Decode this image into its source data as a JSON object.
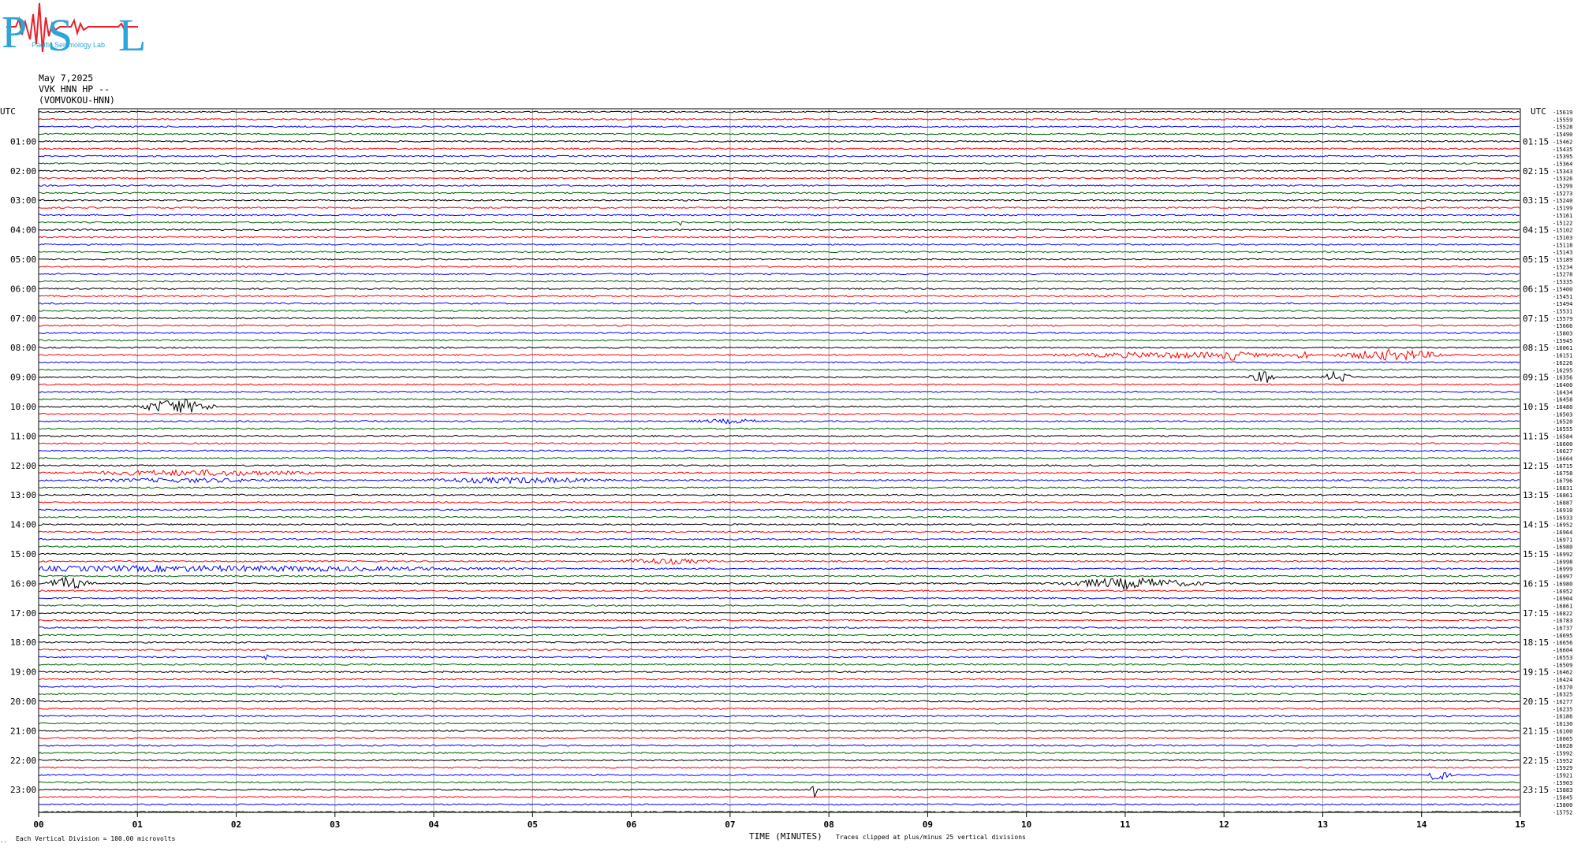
{
  "logo": {
    "letters": "PSL",
    "text": "Pacific Seismology Lab",
    "colors": {
      "letters": "#2aa6d8",
      "trace": "#e8212b"
    }
  },
  "header": {
    "date": "May 7,2025",
    "channel": "VVK HNN HP --",
    "station": "(VOMVOKOU-HNN)"
  },
  "footer": {
    "note_left": "Each Vertical Division =  100.00 microvolts",
    "corner_mark": "..",
    "xaxis_title": "TIME (MINUTES)",
    "clip_note": "Traces clipped at plus/minus 25 vertical divisions"
  },
  "chart_data": {
    "type": "line",
    "subtype": "helicorder",
    "title": "",
    "xlabel": "TIME (MINUTES)",
    "ylabel": "",
    "xlim": [
      0,
      15
    ],
    "x_ticks": [
      "00",
      "01",
      "02",
      "03",
      "04",
      "05",
      "06",
      "07",
      "08",
      "09",
      "10",
      "11",
      "12",
      "13",
      "14",
      "15"
    ],
    "left_axis_title": "UTC",
    "right_axis_title": "UTC",
    "left_hour_labels": [
      "01:00",
      "02:00",
      "03:00",
      "04:00",
      "05:00",
      "06:00",
      "07:00",
      "08:00",
      "09:00",
      "10:00",
      "11:00",
      "12:00",
      "13:00",
      "14:00",
      "15:00",
      "16:00",
      "17:00",
      "18:00",
      "19:00",
      "20:00",
      "21:00",
      "22:00",
      "23:00"
    ],
    "right_hour_labels": [
      "01:15",
      "02:15",
      "03:15",
      "04:15",
      "05:15",
      "06:15",
      "07:15",
      "08:15",
      "09:15",
      "10:15",
      "11:15",
      "12:15",
      "13:15",
      "14:15",
      "15:15",
      "16:15",
      "17:15",
      "18:15",
      "19:15",
      "20:15",
      "21:15",
      "22:15",
      "23:15"
    ],
    "trace_colors": [
      "#000000",
      "#ff0000",
      "#0000ff",
      "#006400"
    ],
    "grid": true,
    "trace_count": 96,
    "right_offsets": [
      "-15619",
      "-15559",
      "-15528",
      "-15490",
      "-15462",
      "-15435",
      "-15395",
      "-15364",
      "-15343",
      "-15326",
      "-15299",
      "-15273",
      "-15240",
      "-15199",
      "-15161",
      "-15122",
      "-15102",
      "-15103",
      "-15118",
      "-15143",
      "-15189",
      "-15234",
      "-15278",
      "-15335",
      "-15400",
      "-15451",
      "-15494",
      "-15531",
      "-15579",
      "-15666",
      "-15803",
      "-15945",
      "-16061",
      "-16151",
      "-16226",
      "-16295",
      "-16356",
      "-16400",
      "-16434",
      "-16458",
      "-16480",
      "-16503",
      "-16520",
      "-16555",
      "-16584",
      "-16600",
      "-16627",
      "-16664",
      "-16715",
      "-16758",
      "-16796",
      "-16831",
      "-16861",
      "-16887",
      "-16910",
      "-16933",
      "-16952",
      "-16964",
      "-16971",
      "-16980",
      "-16992",
      "-16998",
      "-16999",
      "-16997",
      "-16980",
      "-16952",
      "-16904",
      "-16861",
      "-16822",
      "-16783",
      "-16737",
      "-16695",
      "-16656",
      "-16604",
      "-16553",
      "-16509",
      "-16462",
      "-16424",
      "-16370",
      "-16325",
      "-16277",
      "-16235",
      "-16186",
      "-16130",
      "-16100",
      "-16065",
      "-16028",
      "-15992",
      "-15952",
      "-15929",
      "-15921",
      "-15903",
      "-15883",
      "-15845",
      "-15800",
      "-15752"
    ],
    "events": [
      {
        "trace": 15,
        "minute": 6.5,
        "amplitude": 5,
        "width_min": 0.03
      },
      {
        "trace": 2,
        "minute": 0.55,
        "amplitude": 3,
        "width_min": 0.02
      },
      {
        "trace": 27,
        "minute": 8.8,
        "amplitude": 3,
        "width_min": 0.05
      },
      {
        "trace": 33,
        "minute": 11.5,
        "amplitude": 4,
        "width_min": 1.5
      },
      {
        "trace": 33,
        "minute": 12.1,
        "amplitude": 7,
        "width_min": 0.2
      },
      {
        "trace": 33,
        "minute": 12.8,
        "amplitude": 6,
        "width_min": 0.1
      },
      {
        "trace": 33,
        "minute": 13.7,
        "amplitude": 7,
        "width_min": 0.6
      },
      {
        "trace": 36,
        "minute": 12.4,
        "amplitude": 8,
        "width_min": 0.15
      },
      {
        "trace": 36,
        "minute": 13.15,
        "amplitude": 8,
        "width_min": 0.15
      },
      {
        "trace": 40,
        "minute": 1.4,
        "amplitude": 10,
        "width_min": 0.4
      },
      {
        "trace": 42,
        "minute": 7.0,
        "amplitude": 3,
        "width_min": 0.5
      },
      {
        "trace": 49,
        "minute": 1.6,
        "amplitude": 4,
        "width_min": 1.5
      },
      {
        "trace": 50,
        "minute": 4.8,
        "amplitude": 4,
        "width_min": 1.2
      },
      {
        "trace": 50,
        "minute": 1.5,
        "amplitude": 3,
        "width_min": 1.3
      },
      {
        "trace": 61,
        "minute": 6.3,
        "amplitude": 4,
        "width_min": 0.6
      },
      {
        "trace": 62,
        "minute": 1.5,
        "amplitude": 4,
        "width_min": 4
      },
      {
        "trace": 64,
        "minute": 0.3,
        "amplitude": 8,
        "width_min": 0.25
      },
      {
        "trace": 64,
        "minute": 11.05,
        "amplitude": 7,
        "width_min": 0.8
      },
      {
        "trace": 74,
        "minute": 2.3,
        "amplitude": 4,
        "width_min": 0.05
      },
      {
        "trace": 87,
        "minute": 4.7,
        "amplitude": 3,
        "width_min": 0.03
      },
      {
        "trace": 90,
        "minute": 14.15,
        "amplitude": 7,
        "width_min": 0.15
      },
      {
        "trace": 92,
        "minute": 7.85,
        "amplitude": 10,
        "width_min": 0.03
      }
    ]
  }
}
